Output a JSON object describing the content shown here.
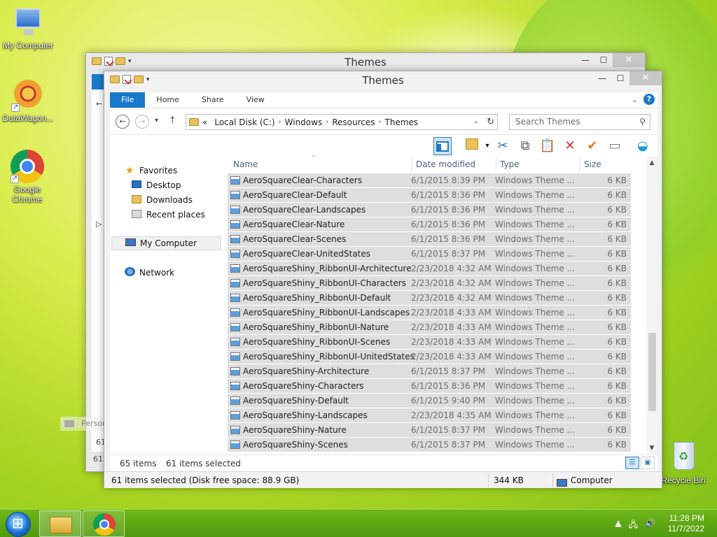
{
  "desktop": {
    "icons": [
      {
        "label": "My Computer"
      },
      {
        "label": "DataWagon..."
      },
      {
        "label": "Google Chrome"
      },
      {
        "label": "Recycle Bin"
      }
    ]
  },
  "back_window": {
    "title": "Themes",
    "fragment_left_num": "61",
    "fragment_bottom_num": "61"
  },
  "ghost": {
    "label": "Personalize"
  },
  "window": {
    "title": "Themes",
    "controls": {
      "minimize": "—",
      "maximize": "☐",
      "close": "✕"
    },
    "tabs": [
      "File",
      "Home",
      "Share",
      "View"
    ],
    "help": "?",
    "address": {
      "overflow": "«",
      "segments": [
        "Local Disk (C:)",
        "Windows",
        "Resources",
        "Themes"
      ],
      "search_placeholder": "Search Themes"
    },
    "nav": {
      "favorites": "Favorites",
      "desktop": "Desktop",
      "downloads": "Downloads",
      "recent": "Recent places",
      "my_computer": "My Computer",
      "network": "Network"
    },
    "columns": {
      "name": "Name",
      "date": "Date modified",
      "type": "Type",
      "size": "Size"
    },
    "files": [
      {
        "name": "AeroSquareClear-Characters",
        "date": "6/1/2015 8:39 PM",
        "type": "Windows Theme ...",
        "size": "6 KB"
      },
      {
        "name": "AeroSquareClear-Default",
        "date": "6/1/2015 8:36 PM",
        "type": "Windows Theme ...",
        "size": "6 KB"
      },
      {
        "name": "AeroSquareClear-Landscapes",
        "date": "6/1/2015 8:36 PM",
        "type": "Windows Theme ...",
        "size": "6 KB"
      },
      {
        "name": "AeroSquareClear-Nature",
        "date": "6/1/2015 8:36 PM",
        "type": "Windows Theme ...",
        "size": "6 KB"
      },
      {
        "name": "AeroSquareClear-Scenes",
        "date": "6/1/2015 8:36 PM",
        "type": "Windows Theme ...",
        "size": "6 KB"
      },
      {
        "name": "AeroSquareClear-UnitedStates",
        "date": "6/1/2015 8:37 PM",
        "type": "Windows Theme ...",
        "size": "6 KB"
      },
      {
        "name": "AeroSquareShiny_RibbonUI-Architecture",
        "date": "2/23/2018 4:32 AM",
        "type": "Windows Theme ...",
        "size": "6 KB"
      },
      {
        "name": "AeroSquareShiny_RibbonUI-Characters",
        "date": "2/23/2018 4:32 AM",
        "type": "Windows Theme ...",
        "size": "6 KB"
      },
      {
        "name": "AeroSquareShiny_RibbonUI-Default",
        "date": "2/23/2018 4:32 AM",
        "type": "Windows Theme ...",
        "size": "6 KB"
      },
      {
        "name": "AeroSquareShiny_RibbonUI-Landscapes",
        "date": "2/23/2018 4:33 AM",
        "type": "Windows Theme ...",
        "size": "6 KB"
      },
      {
        "name": "AeroSquareShiny_RibbonUI-Nature",
        "date": "2/23/2018 4:33 AM",
        "type": "Windows Theme ...",
        "size": "6 KB"
      },
      {
        "name": "AeroSquareShiny_RibbonUI-Scenes",
        "date": "2/23/2018 4:33 AM",
        "type": "Windows Theme ...",
        "size": "6 KB"
      },
      {
        "name": "AeroSquareShiny_RibbonUI-UnitedStates",
        "date": "2/23/2018 4:33 AM",
        "type": "Windows Theme ...",
        "size": "6 KB"
      },
      {
        "name": "AeroSquareShiny-Architecture",
        "date": "6/1/2015 8:37 PM",
        "type": "Windows Theme ...",
        "size": "6 KB"
      },
      {
        "name": "AeroSquareShiny-Characters",
        "date": "6/1/2015 8:36 PM",
        "type": "Windows Theme ...",
        "size": "6 KB"
      },
      {
        "name": "AeroSquareShiny-Default",
        "date": "6/1/2015 9:40 PM",
        "type": "Windows Theme ...",
        "size": "6 KB"
      },
      {
        "name": "AeroSquareShiny-Landscapes",
        "date": "2/23/2018 4:35 AM",
        "type": "Windows Theme ...",
        "size": "6 KB"
      },
      {
        "name": "AeroSquareShiny-Nature",
        "date": "6/1/2015 8:37 PM",
        "type": "Windows Theme ...",
        "size": "6 KB"
      },
      {
        "name": "AeroSquareShiny-Scenes",
        "date": "6/1/2015 8:37 PM",
        "type": "Windows Theme ...",
        "size": "6 KB"
      }
    ],
    "status": {
      "item_count": "65 items",
      "selected": "61 items selected",
      "detail": "61 items selected (Disk free space: 88.9 GB)",
      "size": "344 KB",
      "location": "Computer"
    }
  },
  "taskbar": {
    "time": "11:28 PM",
    "date": "11/7/2022"
  },
  "colors": {
    "accent": "#1979ca",
    "row_selected": "#dedede",
    "taskbar": "#5aa614"
  }
}
